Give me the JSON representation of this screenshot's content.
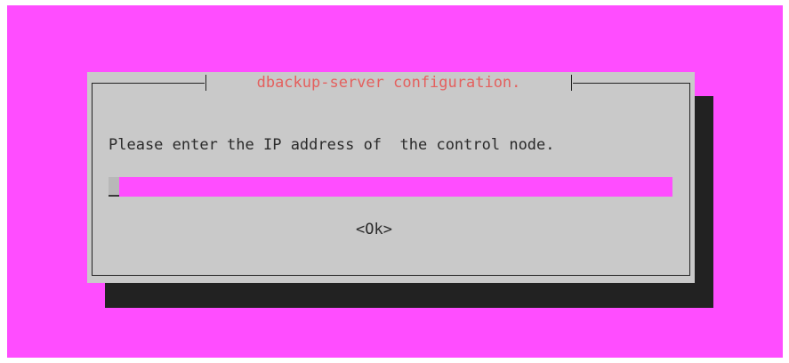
{
  "dialog": {
    "title": "dbackup-server configuration.",
    "prompt": "Please enter the IP address of  the control node.",
    "input_value": "",
    "ok_label": "<Ok>"
  },
  "colors": {
    "screen_background": "#ff4dff",
    "dialog_background": "#c9c9c9",
    "title_text": "#e4605e",
    "shadow": "#222222",
    "input_background": "#ff4dff"
  }
}
